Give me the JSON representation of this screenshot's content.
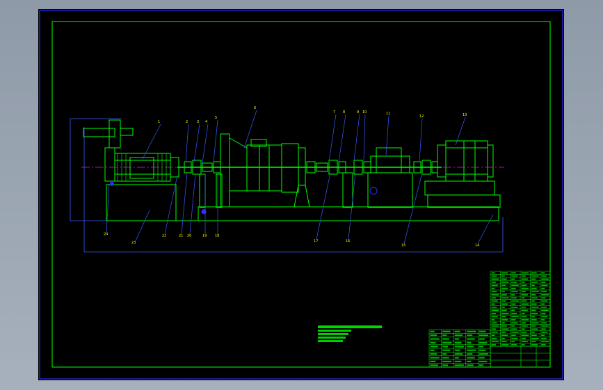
{
  "viewport": {
    "background": "#000000"
  },
  "colors": {
    "frame_outer": "#2d2dff",
    "frame_inner": "#00ff00",
    "outline": "#00ff00",
    "centerline": "#ff00ff",
    "leaders": "#3a5bff",
    "callout_text": "#ffff00",
    "notes": "#00ff00",
    "table_lines": "#00ff00"
  },
  "callouts": {
    "top": [
      "1",
      "2",
      "3",
      "4",
      "5",
      "6",
      "7",
      "8",
      "9",
      "10",
      "11",
      "12",
      "13",
      "14",
      "15",
      "16"
    ],
    "bottom": [
      "24",
      "23",
      "22",
      "21",
      "20",
      "19",
      "18",
      "17",
      "16",
      "15",
      "14",
      "13",
      "12"
    ]
  },
  "notes": {
    "lines": [
      "",
      "",
      ""
    ]
  },
  "parts_table": {
    "rows": 24,
    "columns": 6
  },
  "left_table": {
    "rows": 10,
    "columns": 5
  },
  "title_block": {
    "drawing_number": "",
    "scale": ""
  }
}
